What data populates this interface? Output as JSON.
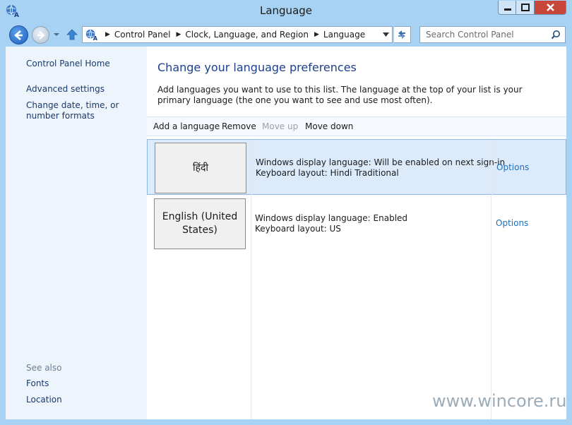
{
  "window": {
    "title": "Language"
  },
  "address": {
    "breadcrumbs": [
      "Control Panel",
      "Clock, Language, and Region",
      "Language"
    ],
    "search_placeholder": "Search Control Panel"
  },
  "sidebar": {
    "links": [
      "Control Panel Home",
      "Advanced settings",
      "Change date, time, or number formats"
    ],
    "see_also_title": "See also",
    "see_also": [
      "Fonts",
      "Location"
    ]
  },
  "main": {
    "heading": "Change your language preferences",
    "intro": "Add languages you want to use to this list. The language at the top of your list is your primary language (the one you want to see and use most often).",
    "toolbar": {
      "add": "Add a language",
      "remove": "Remove",
      "move_up": "Move up",
      "move_down": "Move down"
    },
    "languages": [
      {
        "name": "हिंदी",
        "display": "Windows display language: Will be enabled on next sign-in",
        "keyboard": "Keyboard layout: Hindi Traditional",
        "options": "Options",
        "selected": true
      },
      {
        "name": "English (United States)",
        "display": "Windows display language: Enabled",
        "keyboard": "Keyboard layout: US",
        "options": "Options",
        "selected": false
      }
    ]
  },
  "watermark": "www.wincore.ru",
  "colors": {
    "accent": "#1e3f8c",
    "link": "#1e6fbf",
    "frame": "#a7d2f3",
    "close": "#c8453a"
  }
}
